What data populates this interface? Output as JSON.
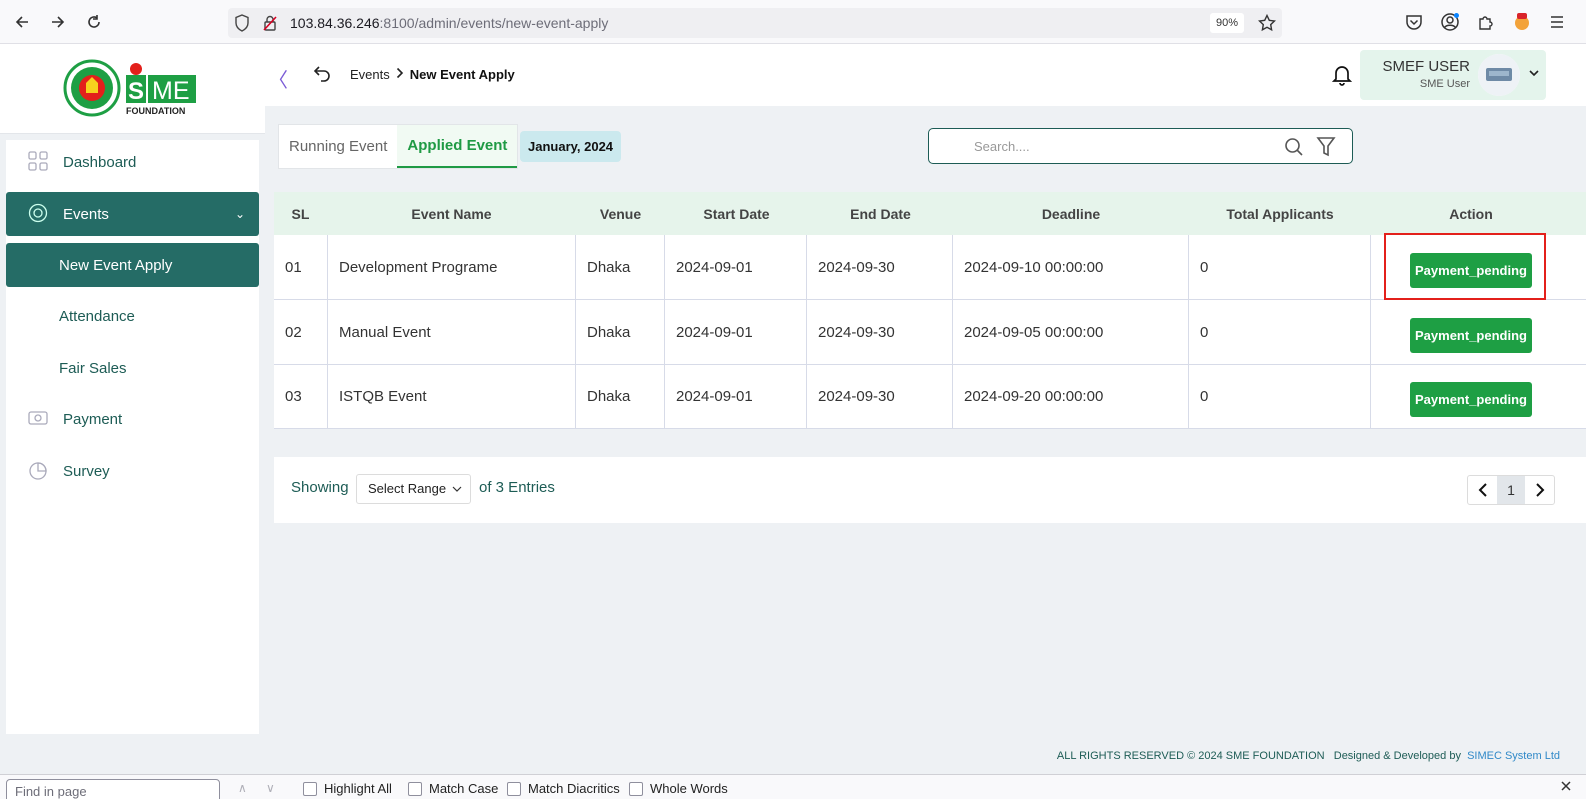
{
  "browser": {
    "url_host": "103.84.36.246",
    "url_rest": ":8100/admin/events/new-event-apply",
    "zoom": "90%"
  },
  "breadcrumb": {
    "parent": "Events",
    "current": "New Event Apply"
  },
  "user": {
    "name": "SMEF USER",
    "role": "SME User"
  },
  "sidebar": {
    "logo_text": "SME",
    "logo_sub": "FOUNDATION",
    "items": [
      {
        "label": "Dashboard"
      },
      {
        "label": "Events"
      },
      {
        "label": "New Event Apply"
      },
      {
        "label": "Attendance"
      },
      {
        "label": "Fair Sales"
      },
      {
        "label": "Payment"
      },
      {
        "label": "Survey"
      }
    ]
  },
  "tabs": {
    "running": "Running Event",
    "applied": "Applied Event",
    "month": "January, 2024"
  },
  "search": {
    "placeholder": "Search...."
  },
  "table": {
    "headers": [
      "SL",
      "Event Name",
      "Venue",
      "Start Date",
      "End Date",
      "Deadline",
      "Total Applicants",
      "Action"
    ],
    "rows": [
      {
        "sl": "01",
        "name": "Development Programe",
        "venue": "Dhaka",
        "start": "2024-09-01",
        "end": "2024-09-30",
        "deadline": "2024-09-10 00:00:00",
        "applicants": "0",
        "action": "Payment_pending"
      },
      {
        "sl": "02",
        "name": "Manual Event",
        "venue": "Dhaka",
        "start": "2024-09-01",
        "end": "2024-09-30",
        "deadline": "2024-09-05 00:00:00",
        "applicants": "0",
        "action": "Payment_pending"
      },
      {
        "sl": "03",
        "name": "ISTQB Event",
        "venue": "Dhaka",
        "start": "2024-09-01",
        "end": "2024-09-30",
        "deadline": "2024-09-20 00:00:00",
        "applicants": "0",
        "action": "Payment_pending"
      }
    ]
  },
  "pagination": {
    "showing": "Showing",
    "range_select": "Select Range",
    "entries": "of 3 Entries",
    "current_page": "1"
  },
  "footer": {
    "rights": "ALL RIGHTS RESERVED © 2024 SME FOUNDATION",
    "designed": "Designed & Developed by",
    "developer": "SIMEC System Ltd"
  },
  "findbar": {
    "placeholder": "Find in page",
    "highlight_all": "Highlight All",
    "match_case": "Match Case",
    "match_diacritics": "Match Diacritics",
    "whole_words": "Whole Words"
  },
  "colors": {
    "primary": "#256c66",
    "accent_green": "#1e9f44",
    "highlight_red": "#e3201b"
  }
}
